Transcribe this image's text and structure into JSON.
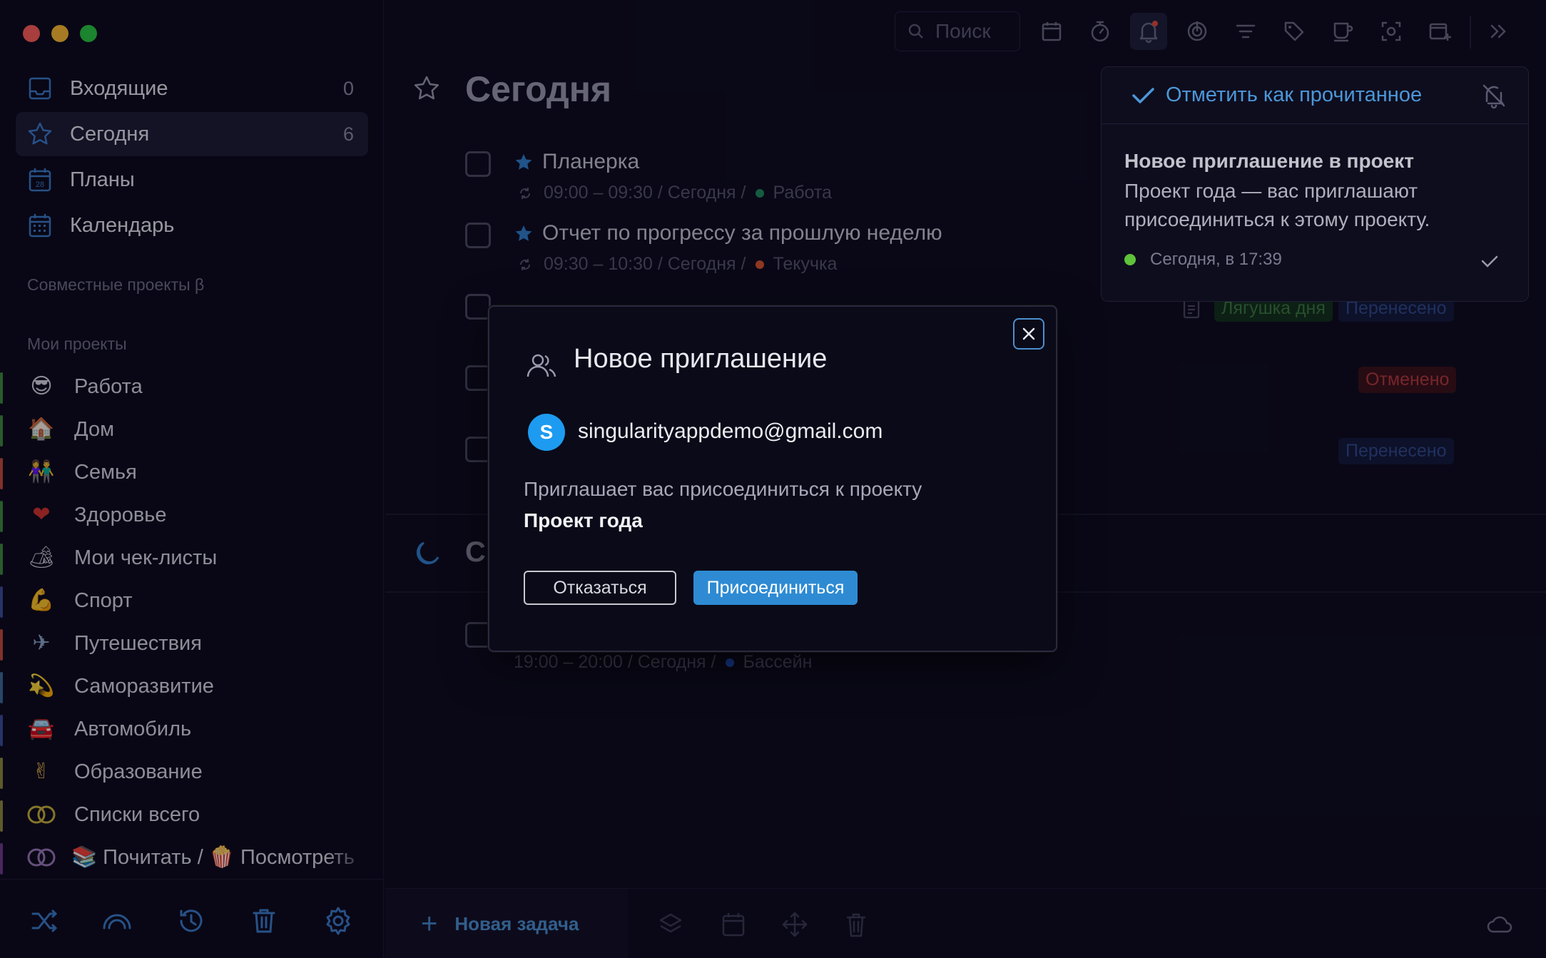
{
  "sidebar": {
    "nav": [
      {
        "label": "Входящие",
        "count": "0",
        "icon": "inbox-icon"
      },
      {
        "label": "Сегодня",
        "count": "6",
        "icon": "star-icon"
      },
      {
        "label": "Планы",
        "count": "",
        "icon": "calendar-28-icon"
      },
      {
        "label": "Календарь",
        "count": "",
        "icon": "calendar-grid-icon"
      }
    ],
    "shared_projects_title": "Совместные проекты β",
    "my_projects_title": "Мои проекты",
    "projects": [
      {
        "label": "Работа",
        "emoji": "😎",
        "color": "#3b8a3b"
      },
      {
        "label": "Дом",
        "emoji": "🏠",
        "color": "#3b8a3b"
      },
      {
        "label": "Семья",
        "emoji": "👫",
        "color": "#c44a3b"
      },
      {
        "label": "Здоровье",
        "emoji": "❤",
        "color": "#3b8a3b"
      },
      {
        "label": "Мои чек-листы",
        "emoji": "🏕",
        "color": "#3b8a3b"
      },
      {
        "label": "Спорт",
        "emoji": "💪",
        "color": "#3b4a9a"
      },
      {
        "label": "Путешествия",
        "emoji": "✈",
        "color": "#c44a3b"
      },
      {
        "label": "Саморазвитие",
        "emoji": "💫",
        "color": "#3b6a9a"
      },
      {
        "label": "Автомобиль",
        "emoji": "🚘",
        "color": "#3b4a9a"
      },
      {
        "label": "Образование",
        "emoji": "✌",
        "color": "#8a8a3b"
      },
      {
        "label": "Списки всего",
        "emoji": "",
        "color": "#8a8a3b"
      },
      {
        "label": "📚 Почитать / 🍿 Посмотреть",
        "emoji": "",
        "color": "#6a3b8a"
      }
    ]
  },
  "toolbar": {
    "search_placeholder": "Поиск"
  },
  "main": {
    "title": "Сегодня",
    "tasks": [
      {
        "title": "Планерка",
        "meta": "09:00 – 09:30 / Сегодня  /",
        "project": "Работа",
        "dot": "#1e8a5a"
      },
      {
        "title": "Отчет по прогрессу за прошлую неделю",
        "meta": "09:30 – 10:30 / Сегодня  /",
        "project": "Текучка",
        "dot": "#d9542b"
      }
    ],
    "evening_task_meta": "19:00 – 20:00 / Сегодня  /",
    "evening_task_project": "Бассейн",
    "evening_dot": "#1f55c9",
    "tags": {
      "frog": "Лягушка дня",
      "postponed1": "Перенесено",
      "cancelled": "Отменено",
      "postponed2": "Перенесено"
    },
    "evening_title_fragment": "С"
  },
  "bottom": {
    "new_task": "Новая задача"
  },
  "notification": {
    "mark_read": "Отметить как прочитанное",
    "title": "Новое приглашение в проект",
    "body": "Проект года — вас приглашают присоединиться к этому проекту.",
    "time": "Сегодня, в 17:39"
  },
  "modal": {
    "title": "Новое приглашение",
    "avatar_letter": "S",
    "email": "singularityappdemo@gmail.com",
    "invite_text": "Приглашает вас присоединиться к проекту",
    "project_name": "Проект года",
    "decline_label": "Отказаться",
    "join_label": "Присоединиться"
  },
  "colors": {
    "accent": "#2e8bd3",
    "background": "#0d0b1d",
    "sidebar": "#0b0a19"
  }
}
